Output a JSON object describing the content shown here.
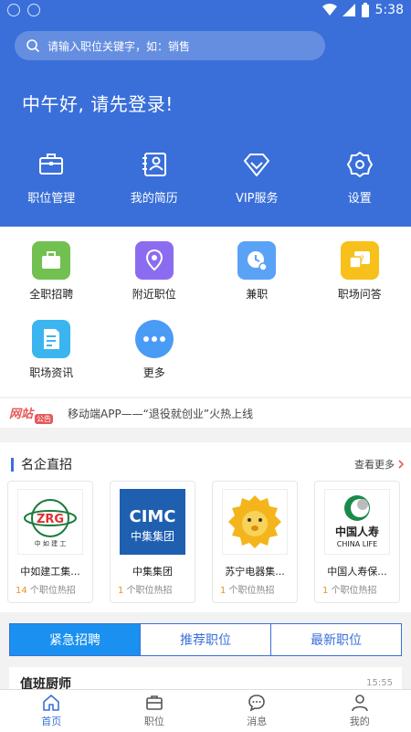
{
  "status": {
    "time": "5:38"
  },
  "search": {
    "placeholder": "请输入职位关键字，如：销售"
  },
  "greeting": "中午好, 请先登录!",
  "quick_actions": [
    {
      "label": "职位管理",
      "icon": "briefcase-icon"
    },
    {
      "label": "我的简历",
      "icon": "resume-icon"
    },
    {
      "label": "VIP服务",
      "icon": "vip-diamond-icon"
    },
    {
      "label": "设置",
      "icon": "gear-icon"
    }
  ],
  "categories": [
    {
      "label": "全职招聘",
      "icon": "fulltime-icon",
      "color": "#72c04f"
    },
    {
      "label": "附近职位",
      "icon": "location-icon",
      "color": "#8b6cf0"
    },
    {
      "label": "兼职",
      "icon": "parttime-clock-icon",
      "color": "#5aa2f5"
    },
    {
      "label": "职场问答",
      "icon": "qa-icon",
      "color": "#f7c01a"
    },
    {
      "label": "职场资讯",
      "icon": "news-icon",
      "color": "#3ab5ef"
    },
    {
      "label": "更多",
      "icon": "more-dots-icon",
      "color": "#4a9bf5"
    }
  ],
  "notice": {
    "badge_main": "网站",
    "badge_sub": "公告",
    "text": "移动端APP——“退役就创业”火热上线"
  },
  "companies_section": {
    "title": "名企直招",
    "see_more": "查看更多",
    "items": [
      {
        "name": "中如建工集...",
        "count": "14",
        "suffix": "个职位热招",
        "logo": "zrg-logo",
        "logo_text": "ZRG",
        "logo_subtext": "中 如 建 工"
      },
      {
        "name": "中集集团",
        "count": "1",
        "suffix": "个职位热招",
        "logo": "cimc-logo",
        "logo_text": "CIMC",
        "logo_subtext": "中集集团"
      },
      {
        "name": "苏宁电器集...",
        "count": "1",
        "suffix": "个职位热招",
        "logo": "suning-lion-logo"
      },
      {
        "name": "中国人寿保...",
        "count": "1",
        "suffix": "个职位热招",
        "logo": "china-life-logo",
        "logo_text": "中国人寿",
        "logo_subtext": "CHINA LIFE"
      }
    ]
  },
  "tabs": [
    "紧急招聘",
    "推荐职位",
    "最新职位"
  ],
  "job": {
    "title": "值班厨师",
    "time": "15:55"
  },
  "bottom_nav": [
    {
      "label": "首页",
      "icon": "home-icon"
    },
    {
      "label": "职位",
      "icon": "briefcase-icon"
    },
    {
      "label": "消息",
      "icon": "message-icon"
    },
    {
      "label": "我的",
      "icon": "user-icon"
    }
  ],
  "colors": {
    "primary": "#3a6fd9",
    "tab_active": "#1a90f0",
    "count_highlight": "#e9922a"
  }
}
